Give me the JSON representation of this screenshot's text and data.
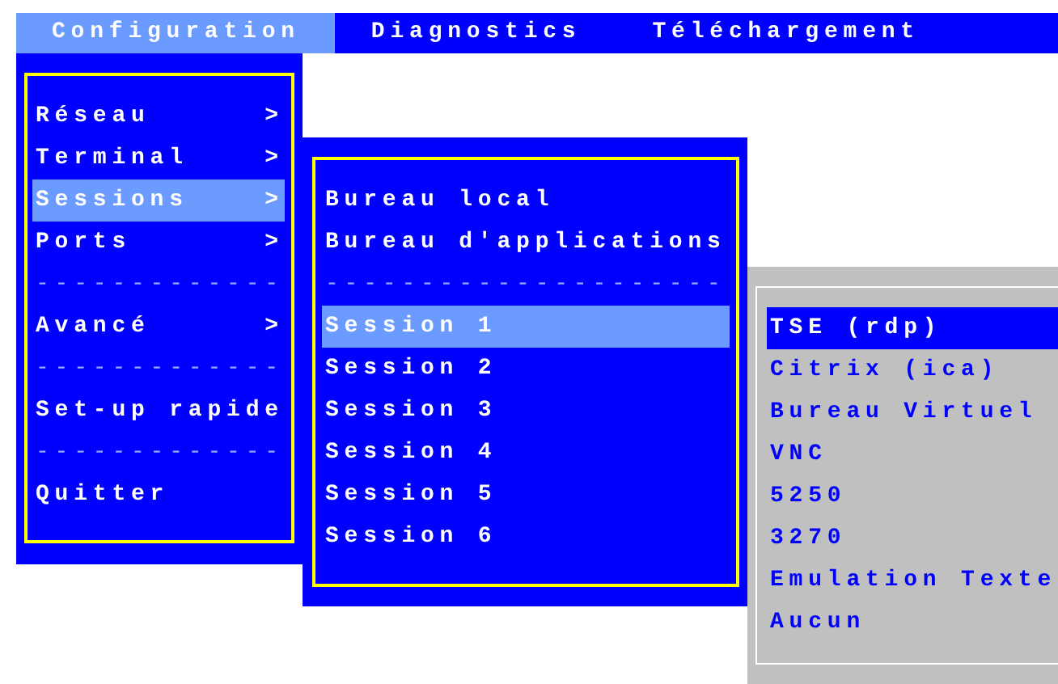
{
  "menu_bar": [
    {
      "label": "Configuration",
      "selected": true
    },
    {
      "label": "Diagnostics",
      "selected": false
    },
    {
      "label": "Téléchargement",
      "selected": false
    }
  ],
  "menus": [
    {
      "kind": "submenu",
      "items": [
        {
          "kind": "item",
          "label": "Réseau",
          "arrow": ">",
          "selected": false
        },
        {
          "kind": "item",
          "label": "Terminal",
          "arrow": ">",
          "selected": false
        },
        {
          "kind": "item",
          "label": "Sessions",
          "arrow": ">",
          "selected": true
        },
        {
          "kind": "item",
          "label": "Ports",
          "arrow": ">",
          "selected": false
        },
        {
          "kind": "separator",
          "text": "-------------"
        },
        {
          "kind": "item",
          "label": "Avancé",
          "arrow": ">",
          "selected": false
        },
        {
          "kind": "separator",
          "text": "-------------"
        },
        {
          "kind": "item",
          "label": "Set-up rapide",
          "selected": false
        },
        {
          "kind": "separator",
          "text": "-------------"
        },
        {
          "kind": "item",
          "label": "Quitter",
          "selected": false
        }
      ]
    },
    {
      "kind": "submenu",
      "items": [
        {
          "kind": "item",
          "label": "Bureau local",
          "selected": false
        },
        {
          "kind": "item",
          "label": "Bureau d'applications",
          "selected": false
        },
        {
          "kind": "separator",
          "text": "---------------------"
        },
        {
          "kind": "item",
          "label": "Session 1",
          "selected": true
        },
        {
          "kind": "item",
          "label": "Session 2",
          "selected": false
        },
        {
          "kind": "item",
          "label": "Session 3",
          "selected": false
        },
        {
          "kind": "item",
          "label": "Session 4",
          "selected": false
        },
        {
          "kind": "item",
          "label": "Session 5",
          "selected": false
        },
        {
          "kind": "item",
          "label": "Session 6",
          "selected": false
        }
      ]
    },
    {
      "kind": "options",
      "items": [
        {
          "kind": "item",
          "label": "TSE (rdp)",
          "selected": true
        },
        {
          "kind": "item",
          "label": "Citrix (ica)",
          "selected": false
        },
        {
          "kind": "item",
          "label": "Bureau Virtuel",
          "selected": false
        },
        {
          "kind": "item",
          "label": "VNC",
          "selected": false
        },
        {
          "kind": "item",
          "label": "5250",
          "selected": false
        },
        {
          "kind": "item",
          "label": "3270",
          "selected": false
        },
        {
          "kind": "item",
          "label": "Emulation Texte",
          "selected": false
        },
        {
          "kind": "item",
          "label": "Aucun",
          "selected": false
        }
      ]
    }
  ]
}
